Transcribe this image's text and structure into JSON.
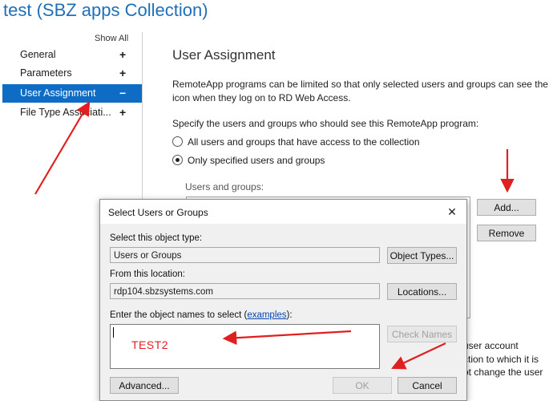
{
  "page": {
    "title": "test (SBZ apps Collection)"
  },
  "sidebar": {
    "show_all": "Show All",
    "items": [
      {
        "label": "General",
        "sign": "+"
      },
      {
        "label": "Parameters",
        "sign": "+"
      },
      {
        "label": "User Assignment",
        "sign": "−"
      },
      {
        "label": "File Type Associati...",
        "sign": "+"
      }
    ],
    "active_index": 2
  },
  "main": {
    "heading": "User Assignment",
    "description_line1": "RemoteApp programs can be limited so that only selected users and groups can see the",
    "description_line2": "icon when they log on to RD Web Access.",
    "specify_text": "Specify the users and groups who should see this RemoteApp program:",
    "radio_all": "All users and groups that have access to the collection",
    "radio_specified": "Only specified users and groups",
    "selected_radio": "specified",
    "users_groups_label": "Users and groups:",
    "add_button": "Add...",
    "remove_button": "Remove",
    "partial_line1": "user account",
    "partial_line2": "ction to which it is",
    "partial_line3": "ot change the user"
  },
  "dialog": {
    "title": "Select Users or Groups",
    "close_glyph": "✕",
    "object_type_label": "Select this object type:",
    "object_type_value": "Users or Groups",
    "object_types_button": "Object Types...",
    "location_label": "From this location:",
    "location_value": "rdp104.sbzsystems.com",
    "locations_button": "Locations...",
    "names_label_prefix": "Enter the object names to select (",
    "names_label_link": "examples",
    "names_label_suffix": "):",
    "typed_value": "TEST2",
    "check_names_button": "Check Names",
    "advanced_button": "Advanced...",
    "ok_button": "OK",
    "cancel_button": "Cancel"
  },
  "colors": {
    "title_blue": "#1f6fb8",
    "active_nav": "#0e6cc4",
    "annotation_red": "#e02020"
  }
}
